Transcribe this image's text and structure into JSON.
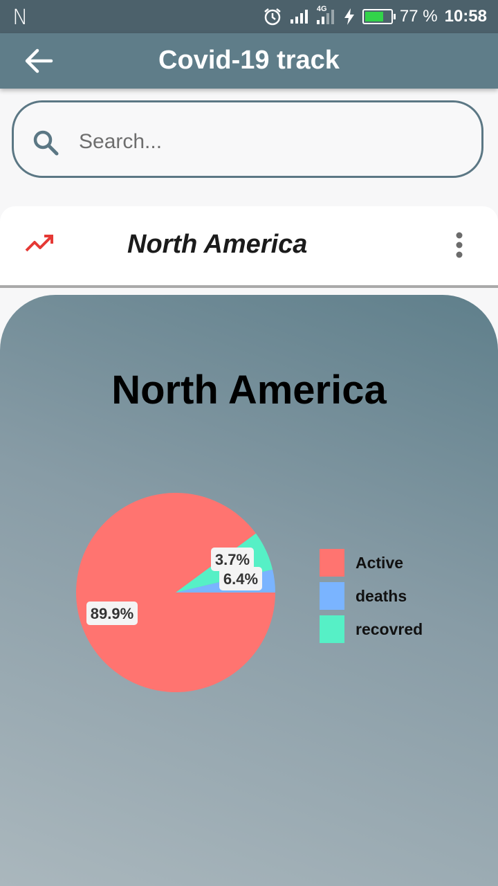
{
  "status_bar": {
    "left_glyph": "N",
    "signal_tag": "4G",
    "battery": "77 %",
    "time": "10:58",
    "battery_level": 0.77,
    "icons": [
      "alarm-icon",
      "signal-icon",
      "charging-icon",
      "battery-icon"
    ]
  },
  "app_bar": {
    "title": "Covid-19 track",
    "back_icon": "arrow-left-icon"
  },
  "search": {
    "placeholder": "Search...",
    "value": "",
    "icon": "search-icon"
  },
  "region_row": {
    "name": "North America",
    "trend_icon": "trending-up-icon",
    "menu_icon": "more-vertical-icon"
  },
  "colors": {
    "status_bar": "#4c616b",
    "app_bar": "#5f7d89",
    "active": "#ff7470",
    "deaths": "#7ab4ff",
    "recovered": "#56f0c6",
    "trend": "#e53935"
  },
  "chart_data": {
    "type": "pie",
    "title": "North America",
    "categories": [
      "Active",
      "deaths",
      "recovred"
    ],
    "values": [
      89.9,
      3.7,
      6.4
    ],
    "labels": [
      "89.9%",
      "3.7%",
      "6.4%"
    ],
    "colors": [
      "#ff7470",
      "#7ab4ff",
      "#56f0c6"
    ],
    "legend_position": "right"
  }
}
